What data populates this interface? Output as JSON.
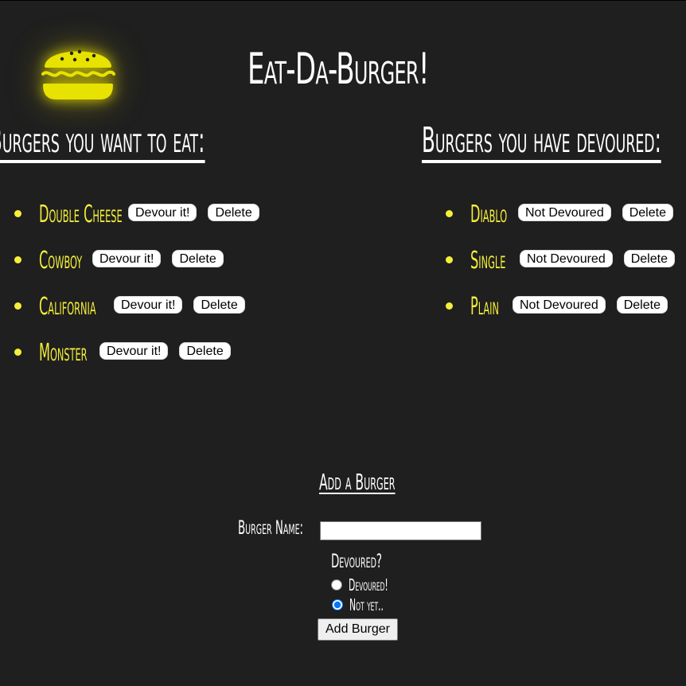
{
  "header": {
    "title": "Eat-Da-Burger!",
    "logo_icon": "burger-icon"
  },
  "colors": {
    "background": "#1f1f1f",
    "accent_yellow": "#f5ef3a",
    "text": "#ffffff"
  },
  "to_eat": {
    "heading": "Burgers you want to eat:",
    "items": [
      {
        "name": "Double Cheese",
        "action_label": "Devour it!",
        "delete_label": "Delete"
      },
      {
        "name": "Cowboy",
        "action_label": "Devour it!",
        "delete_label": "Delete"
      },
      {
        "name": "California",
        "action_label": "Devour it!",
        "delete_label": "Delete"
      },
      {
        "name": "Monster",
        "action_label": "Devour it!",
        "delete_label": "Delete"
      }
    ]
  },
  "devoured": {
    "heading": "Burgers you have devoured:",
    "items": [
      {
        "name": "Diablo",
        "action_label": "Not Devoured",
        "delete_label": "Delete"
      },
      {
        "name": "Single",
        "action_label": "Not Devoured",
        "delete_label": "Delete"
      },
      {
        "name": "Plain",
        "action_label": "Not Devoured",
        "delete_label": "Delete"
      }
    ]
  },
  "add_form": {
    "heading": "Add a Burger",
    "name_label": "Burger Name:",
    "name_value": "",
    "devoured_label": "Devoured?",
    "options": [
      {
        "label": "Devoured!",
        "checked": false
      },
      {
        "label": "Not yet..",
        "checked": true
      }
    ],
    "submit_label": "Add Burger"
  }
}
